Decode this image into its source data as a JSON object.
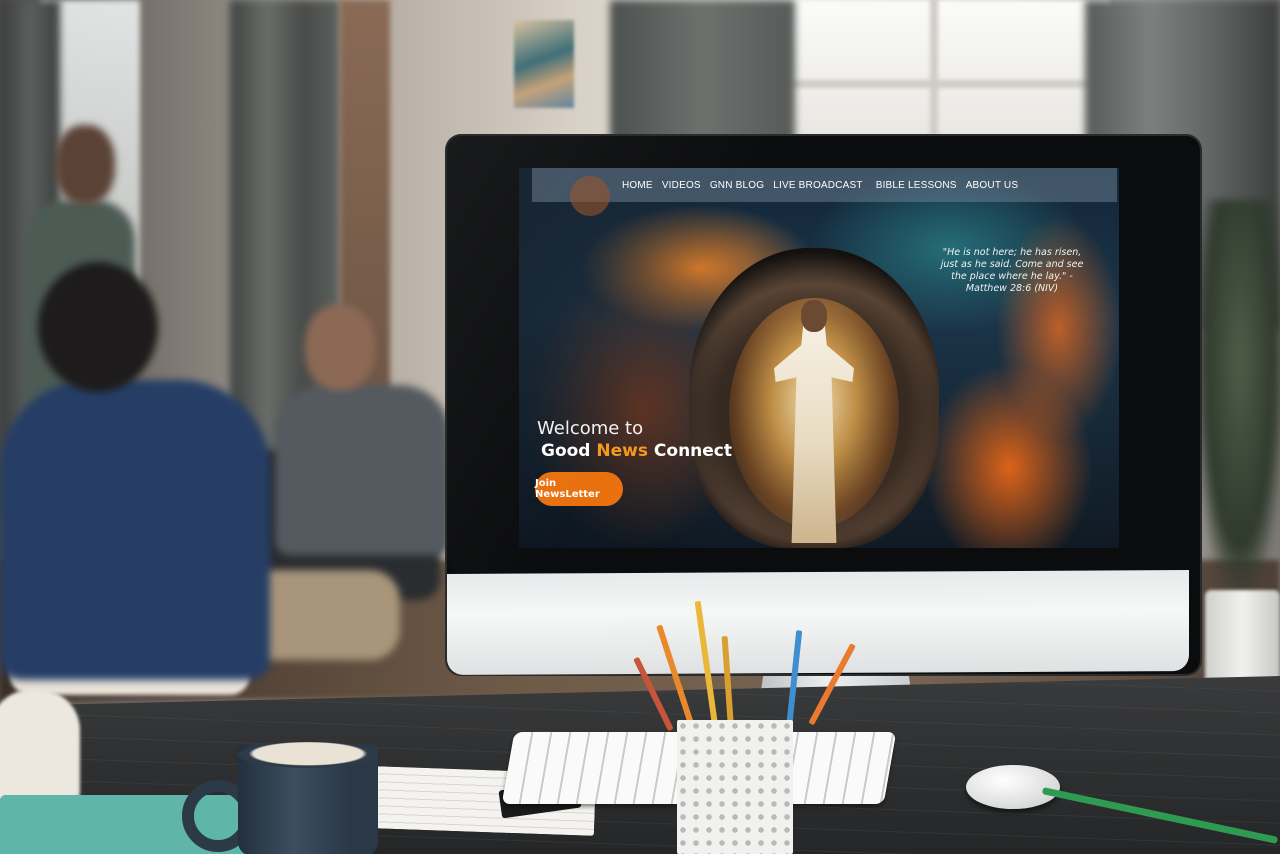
{
  "website": {
    "nav": {
      "items": [
        "HOME",
        "VIDEOS",
        "GNN BLOG",
        "LIVE BROADCAST",
        "BIBLE LESSONS",
        "ABOUT US"
      ]
    },
    "verse": "\"He is not here; he has risen, just as he said. Come and see the place where he lay.\" - Matthew 28:6 (NIV)",
    "hero": {
      "welcome": "Welcome to",
      "brand_part1": "Good",
      "brand_part2": "News",
      "brand_part3": "Connect",
      "join_button": "Join  NewsLetter"
    }
  },
  "colors": {
    "accent_orange": "#f39a1f",
    "button_orange": "#e8700f",
    "nav_bar": "#788ca0"
  },
  "objects": [
    "monitor",
    "keyboard",
    "mouse",
    "mug",
    "pencil-pot",
    "notebook",
    "teal-folder"
  ]
}
